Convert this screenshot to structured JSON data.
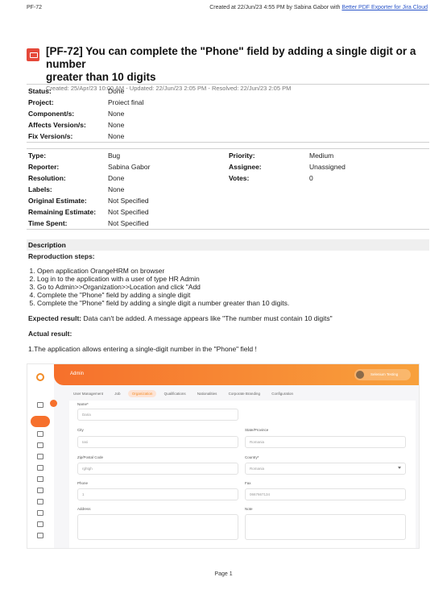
{
  "header": {
    "issue_key": "PF-72",
    "created_line": "Created at 22/Jun/23 4:55 PM by Sabina Gabor with ",
    "exporter_link": "Better PDF Exporter for Jira Cloud"
  },
  "issue": {
    "title": "[PF-72] You can complete the \"Phone\" field by adding a single digit or a number greater than 10 digits",
    "title_line1": "[PF-72] You can complete the \"Phone\" field by adding a single digit or a number",
    "title_line2": "greater than 10 digits",
    "dates": "Created: 25/Apr/23 10:00 AM - Updated: 22/Jun/23 2:05 PM - Resolved: 22/Jun/23 2:05 PM"
  },
  "fields1": [
    {
      "label": "Status:",
      "value": "Done"
    },
    {
      "label": "Project:",
      "value": "Proiect final"
    },
    {
      "label": "Component/s:",
      "value": "None"
    },
    {
      "label": "Affects Version/s:",
      "value": "None"
    },
    {
      "label": "Fix Version/s:",
      "value": "None"
    }
  ],
  "fields2": {
    "type": {
      "label": "Type:",
      "value": "Bug"
    },
    "priority": {
      "label": "Priority:",
      "value": "Medium"
    },
    "reporter": {
      "label": "Reporter:",
      "value": "Sabina Gabor"
    },
    "assignee": {
      "label": "Assignee:",
      "value": "Unassigned"
    },
    "resolution": {
      "label": "Resolution:",
      "value": "Done"
    },
    "votes": {
      "label": "Votes:",
      "value": "0"
    },
    "labels": {
      "label": "Labels:",
      "value": "None"
    },
    "original_estimate": {
      "label": "Original Estimate:",
      "value": "Not Specified"
    },
    "remaining_estimate": {
      "label": "Remaining Estimate:",
      "value": "Not Specified"
    },
    "time_spent": {
      "label": "Time Spent:",
      "value": "Not Specified"
    }
  },
  "description": {
    "heading": "Description",
    "steps_heading": "Reproduction steps:",
    "steps": [
      "Open application OrangeHRM on browser",
      "Log in to the application with a user of type HR Admin",
      "Go to Admin>>Organization>>Location and click \"Add",
      "Complete the \"Phone\" field by adding a single digit",
      "Complete the \"Phone\" field by adding a single digit a number greater than 10 digits."
    ],
    "expected_label": "Expected result:",
    "expected_text": " Data can't be added. A message appears like \"The number must contain 10 digits\"",
    "actual_heading": "Actual result:",
    "actual_text": "1.The application allows entering a single-digit number in the \"Phone\" field !"
  },
  "screenshot": {
    "module": "Admin",
    "user_name": "Selenium Testing",
    "nav": [
      "User Management",
      "Job",
      "Organization",
      "Qualifications",
      "Nationalities",
      "Corporate Branding",
      "Configuration"
    ],
    "active_nav": "Organization",
    "name_label": "Name*",
    "name_value": "Daria",
    "city_label": "City",
    "city_value": "Iasi",
    "state_label": "State/Province",
    "state_value": "Romania",
    "zip_label": "Zip/Postal Code",
    "zip_value": "rghtgh",
    "country_label": "Country*",
    "country_value": "Romania",
    "phone_label": "Phone",
    "phone_value": "1",
    "fax_label": "Fax",
    "fax_value": "0667667134",
    "address_label": "Address",
    "note_label": "Note"
  },
  "footer": {
    "page": "Page 1"
  }
}
